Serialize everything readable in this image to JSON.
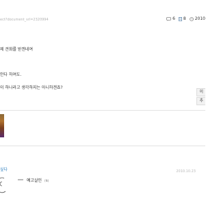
{
  "url": "ect?document_srl=2320994",
  "stats": {
    "comments": "6",
    "doc": "8",
    "date": "2010"
  },
  "body": {
    "line1": "제 견화를 받겐네여",
    "line2": "안다 하여도.",
    "line3": "이 하나라고 생각하지는 아니하겐죠?"
  },
  "side_buttons": [
    "이",
    "추"
  ],
  "comment": {
    "author": "싶다",
    "time": "2010.10.23",
    "reply_name": "예고살인",
    "reply_badge": "N"
  }
}
